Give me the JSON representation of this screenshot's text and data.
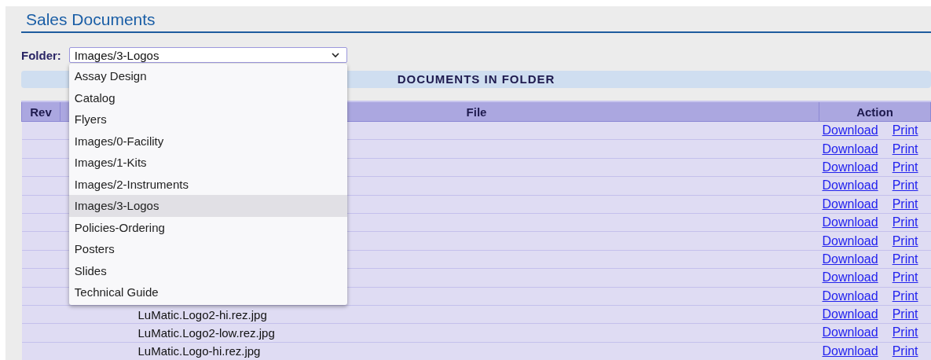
{
  "page": {
    "title": "Sales Documents"
  },
  "folder": {
    "label": "Folder:",
    "value": "Images/3-Logos",
    "expanded": true,
    "options": [
      {
        "label": "Assay Design",
        "selected": false
      },
      {
        "label": "Catalog",
        "selected": false
      },
      {
        "label": "Flyers",
        "selected": false
      },
      {
        "label": "Images/0-Facility",
        "selected": false
      },
      {
        "label": "Images/1-Kits",
        "selected": false
      },
      {
        "label": "Images/2-Instruments",
        "selected": false
      },
      {
        "label": "Images/3-Logos",
        "selected": true
      },
      {
        "label": "Policies-Ordering",
        "selected": false
      },
      {
        "label": "Posters",
        "selected": false
      },
      {
        "label": "Slides",
        "selected": false
      },
      {
        "label": "Technical Guide",
        "selected": false
      }
    ]
  },
  "documents": {
    "title": "DOCUMENTS IN FOLDER",
    "columns": [
      "Rev",
      "File",
      "Action"
    ],
    "rows": [
      {
        "download": "Download",
        "print": "Print"
      },
      {
        "download": "Download",
        "print": "Print"
      },
      {
        "download": "Download",
        "print": "Print"
      },
      {
        "download": "Download",
        "print": "Print"
      },
      {
        "download": "Download",
        "print": "Print"
      },
      {
        "download": "Download",
        "print": "Print"
      },
      {
        "download": "Download",
        "print": "Print"
      },
      {
        "download": "Download",
        "print": "Print"
      },
      {
        "download": "Download",
        "print": "Print"
      },
      {
        "download": "Download",
        "print": "Print"
      },
      {
        "file": "LuMatic.Logo2-hi.rez.jpg",
        "download": "Download",
        "print": "Print"
      },
      {
        "file": "LuMatic.Logo2-low.rez.jpg",
        "download": "Download",
        "print": "Print"
      },
      {
        "file": "LuMatic.Logo-hi.rez.jpg",
        "download": "Download",
        "print": "Print"
      }
    ]
  }
}
